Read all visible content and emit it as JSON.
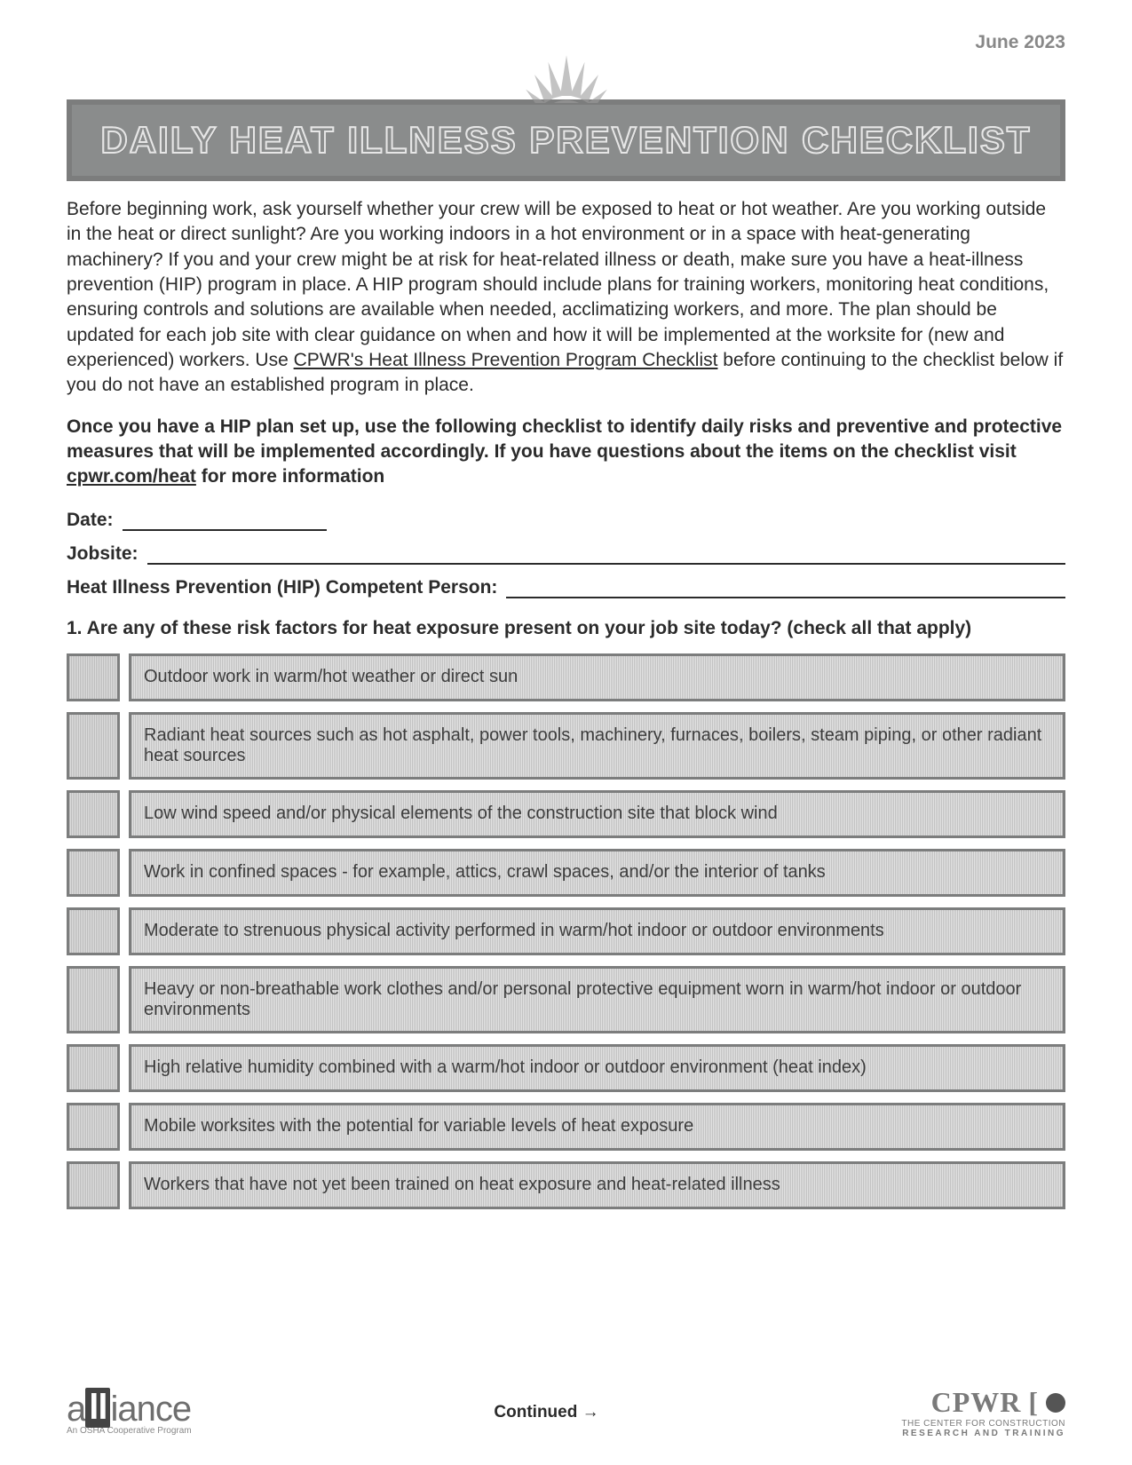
{
  "header_date": "June 2023",
  "banner_title": "DAILY HEAT ILLNESS PREVENTION CHECKLIST",
  "intro_text_before_link": "Before beginning work, ask yourself whether your crew will be exposed to heat or hot weather. Are you working outside in the heat or direct sunlight? Are you working indoors in a hot environment or in a space with heat-generating machinery? If you and your crew might be at risk for heat-related illness or death, make sure you have a heat-illness prevention (HIP) program in place. A HIP program should include plans for training workers, monitoring heat conditions, ensuring controls and solutions are available when needed, acclimatizing workers, and more. The plan should be updated for each job site with clear guidance on when and how it will be implemented at the worksite for (new and experienced) workers. Use ",
  "intro_link_text": "CPWR's Heat Illness Prevention Program Checklist",
  "intro_text_after_link": " before continuing to the checklist below if you do not have an established program in place.",
  "bold_para_before": "Once you have a HIP plan set up, use the following checklist to identify daily risks and preventive and protective measures that will be implemented accordingly. If you have questions about the items on the checklist visit ",
  "bold_para_link": "cpwr.com/heat",
  "bold_para_after": " for more information",
  "fields": {
    "date_label": "Date:",
    "jobsite_label": "Jobsite:",
    "hip_label": "Heat Illness Prevention (HIP) Competent Person:"
  },
  "question1": "1. Are any of these risk factors for heat exposure present on your job site today? (check all that apply)",
  "risk_factors": [
    "Outdoor work in warm/hot weather or direct sun",
    "Radiant heat sources such as hot asphalt, power tools, machinery, furnaces, boilers, steam piping, or other radiant heat sources",
    "Low wind speed and/or physical elements of the construction site that block wind",
    "Work in confined spaces - for example, attics, crawl spaces, and/or the interior of tanks",
    "Moderate to strenuous physical activity performed in warm/hot indoor or outdoor environments",
    "Heavy or non-breathable work clothes and/or personal protective equipment worn in warm/hot indoor or outdoor environments",
    "High relative humidity combined with a warm/hot indoor or outdoor environment (heat index)",
    "Mobile worksites with the potential for variable levels of heat exposure",
    "Workers that have not yet been trained on heat exposure and heat-related illness"
  ],
  "continued": "Continued →",
  "footer": {
    "alliance": "alliance",
    "alliance_sub": "An OSHA Cooperative Program",
    "cpwr": "CPWR",
    "cpwr_sub1": "THE CENTER FOR CONSTRUCTION",
    "cpwr_sub2": "RESEARCH AND TRAINING"
  }
}
